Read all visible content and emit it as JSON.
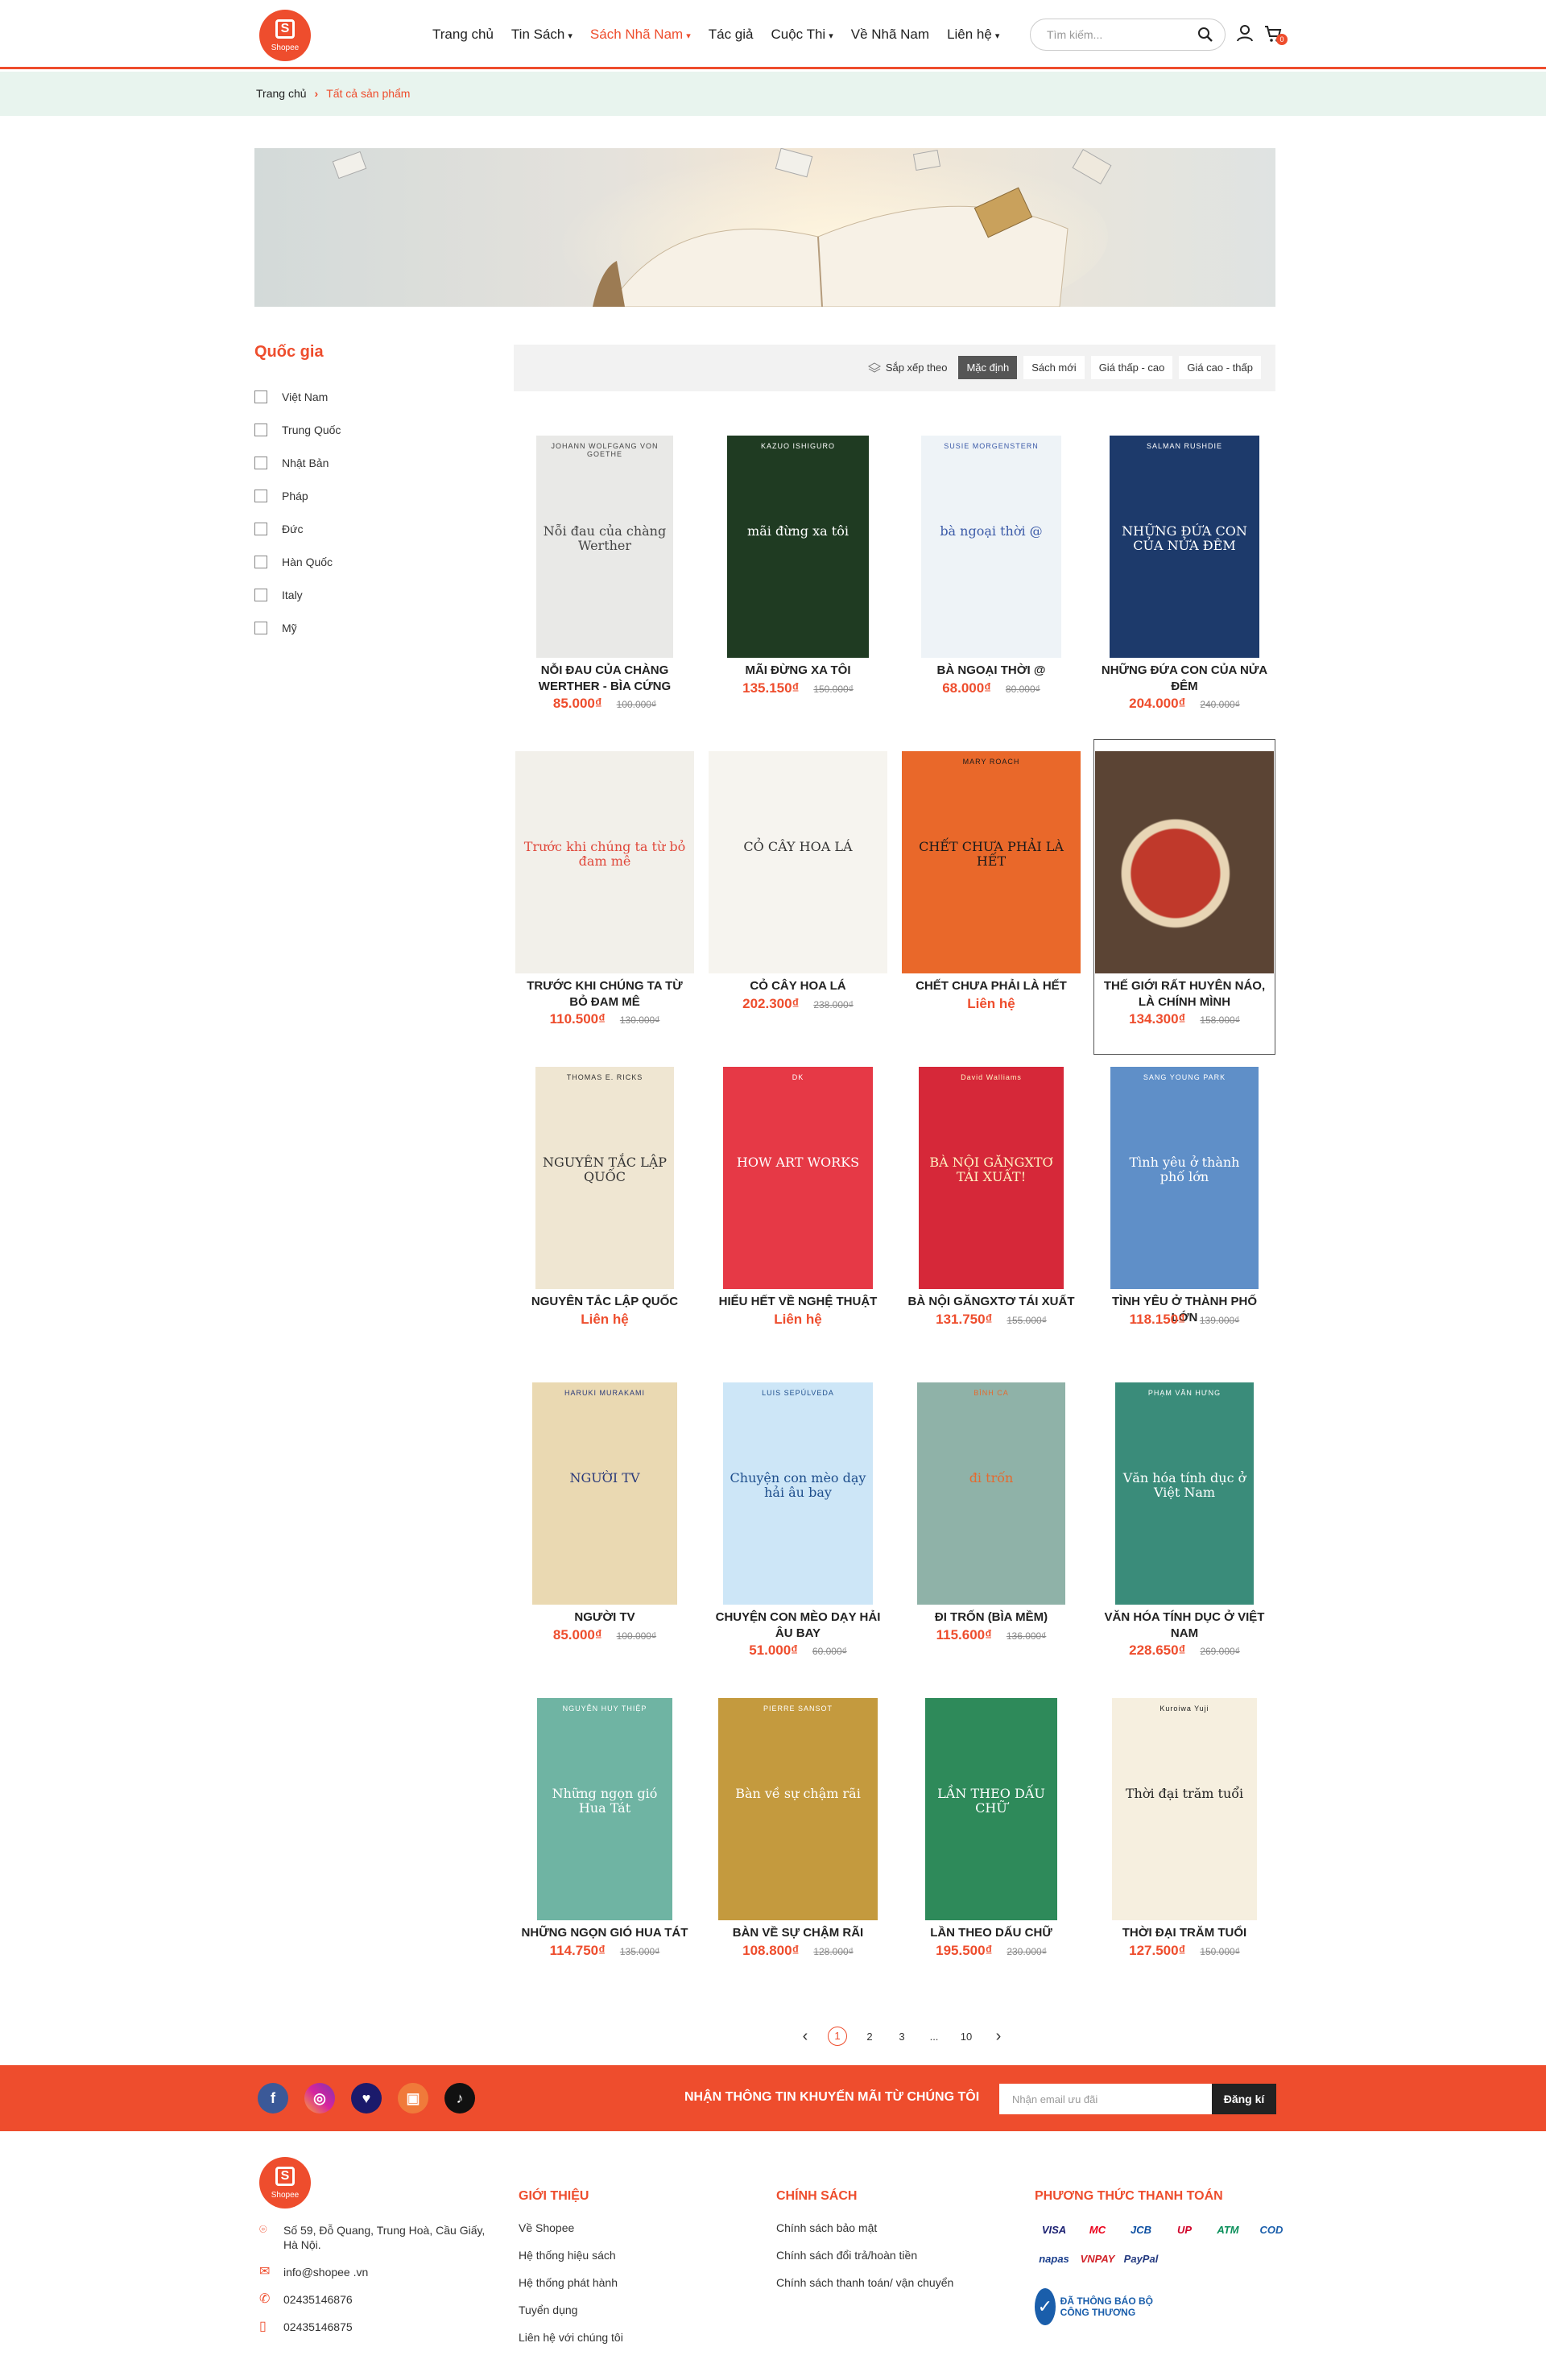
{
  "header": {
    "logo_text": "Shopee",
    "nav": [
      {
        "label": "Trang chủ",
        "dropdown": false,
        "active": false
      },
      {
        "label": "Tin Sách",
        "dropdown": true,
        "active": false
      },
      {
        "label": "Sách Nhã Nam",
        "dropdown": true,
        "active": true
      },
      {
        "label": "Tác giả",
        "dropdown": false,
        "active": false
      },
      {
        "label": "Cuộc Thi",
        "dropdown": true,
        "active": false
      },
      {
        "label": "Về Nhã Nam",
        "dropdown": false,
        "active": false
      },
      {
        "label": "Liên hệ",
        "dropdown": true,
        "active": false
      }
    ],
    "search_placeholder": "Tìm kiếm...",
    "cart_count": "0"
  },
  "breadcrumb": {
    "home": "Trang chủ",
    "current": "Tất cả sản phẩm"
  },
  "sidebar": {
    "title": "Quốc gia",
    "countries": [
      "Việt Nam",
      "Trung Quốc",
      "Nhật Bản",
      "Pháp",
      "Đức",
      "Hàn Quốc",
      "Italy",
      "Mỹ"
    ]
  },
  "sort": {
    "label": "Sắp xếp theo",
    "options": [
      "Mặc định",
      "Sách mới",
      "Giá thấp - cao",
      "Giá cao - thấp"
    ],
    "active": "Mặc định"
  },
  "products": [
    {
      "name": "Nỗi đau của chàng Werther - bìa cứng",
      "price": "85.000₫",
      "old": "100.000₫",
      "cover_title": "Nỗi đau của chàng Werther",
      "cover_author": "JOHANN WOLFGANG VON GOETHE",
      "bg": "#e9e9e7",
      "fg": "#444"
    },
    {
      "name": "Mãi đừng xa tôi",
      "price": "135.150₫",
      "old": "150.000₫",
      "cover_title": "mãi đừng xa tôi",
      "cover_author": "KAZUO ISHIGURO",
      "bg": "#1f3b22",
      "fg": "#fff"
    },
    {
      "name": "Bà ngoại thời @",
      "price": "68.000₫",
      "old": "80.000₫",
      "cover_title": "bà ngoại thời @",
      "cover_author": "SUSIE MORGENSTERN",
      "bg": "#eef3f7",
      "fg": "#3b5aa8"
    },
    {
      "name": "Những đứa con của nửa đêm",
      "price": "204.000₫",
      "old": "240.000₫",
      "cover_title": "NHỮNG ĐỨA CON CỦA NỬA ĐÊM",
      "cover_author": "SALMAN RUSHDIE",
      "bg": "#1d3a6b",
      "fg": "#fff"
    },
    {
      "name": "Trước khi chúng ta từ bỏ đam mê",
      "price": "110.500₫",
      "old": "130.000₫",
      "cover_title": "Trước khi chúng ta từ bỏ đam mê",
      "cover_author": "",
      "bg": "#f2f0ea",
      "fg": "#e0483b"
    },
    {
      "name": "Cỏ cây hoa lá",
      "price": "202.300₫",
      "old": "238.000₫",
      "cover_title": "CỎ CÂY HOA LÁ",
      "cover_author": "",
      "bg": "#f6f4ef",
      "fg": "#333"
    },
    {
      "name": "Chết chưa phải là hết",
      "price": "Liên hệ",
      "old": "",
      "cover_title": "CHẾT CHƯA PHẢI LÀ HẾT",
      "cover_author": "MARY ROACH",
      "bg": "#e9682a",
      "fg": "#1a1a1a"
    },
    {
      "name": "Thế giới rất huyên náo, là chính mình",
      "price": "134.300₫",
      "old": "158.000₫",
      "cover_title": "",
      "cover_author": "",
      "bg": "#5b4434",
      "fg": "#fff",
      "selected": true
    },
    {
      "name": "Nguyên tắc lập quốc",
      "price": "Liên hệ",
      "old": "",
      "cover_title": "NGUYÊN TẮC LẬP QUỐC",
      "cover_author": "THOMAS E. RICKS",
      "bg": "#efe6d2",
      "fg": "#333"
    },
    {
      "name": "Hiểu hết về nghệ thuật",
      "price": "Liên hệ",
      "old": "",
      "cover_title": "HOW ART WORKS",
      "cover_author": "DK",
      "bg": "#e63946",
      "fg": "#fff"
    },
    {
      "name": "Bà nội găngxtơ tái xuất",
      "price": "131.750₫",
      "old": "155.000₫",
      "cover_title": "BÀ NỘI GĂNGXTƠ TÁI XUẤT!",
      "cover_author": "David Walliams",
      "bg": "#d62839",
      "fg": "#fff4c2"
    },
    {
      "name": "Tình yêu ở thành phố lớn",
      "price": "118.150₫",
      "old": "139.000₫",
      "cover_title": "Tình yêu ở thành phố lớn",
      "cover_author": "SANG YOUNG PARK",
      "bg": "#5f8fc8",
      "fg": "#fff"
    },
    {
      "name": "Người TV",
      "price": "85.000₫",
      "old": "100.000₫",
      "cover_title": "NGƯỜI TV",
      "cover_author": "HARUKI MURAKAMI",
      "bg": "#ead9b2",
      "fg": "#2a3a7a"
    },
    {
      "name": "Chuyện con mèo dạy hải âu bay",
      "price": "51.000₫",
      "old": "60.000₫",
      "cover_title": "Chuyện con mèo dạy hải âu bay",
      "cover_author": "LUIS SEPÚLVEDA",
      "bg": "#cde6f7",
      "fg": "#1e4e8c"
    },
    {
      "name": "Đi trốn (bìa mềm)",
      "price": "115.600₫",
      "old": "136.000₫",
      "cover_title": "đi trốn",
      "cover_author": "BÌNH CA",
      "bg": "#8fb2a8",
      "fg": "#e56a2e"
    },
    {
      "name": "Văn hóa tính dục ở Việt Nam",
      "price": "228.650₫",
      "old": "269.000₫",
      "cover_title": "Văn hóa tính dục ở Việt Nam",
      "cover_author": "PHẠM VĂN HƯNG",
      "bg": "#3a8c7a",
      "fg": "#fff"
    },
    {
      "name": "Những ngọn gió Hua Tát",
      "price": "114.750₫",
      "old": "135.000₫",
      "cover_title": "Những ngọn gió Hua Tát",
      "cover_author": "NGUYỄN HUY THIỆP",
      "bg": "#6fb4a3",
      "fg": "#fff"
    },
    {
      "name": "Bàn về sự chậm rãi",
      "price": "108.800₫",
      "old": "128.000₫",
      "cover_title": "Bàn về sự chậm rãi",
      "cover_author": "PIERRE SANSOT",
      "bg": "#c49a3e",
      "fg": "#fff"
    },
    {
      "name": "Lần theo dấu chữ",
      "price": "195.500₫",
      "old": "230.000₫",
      "cover_title": "LẦN THEO DẤU CHỮ",
      "cover_author": "",
      "bg": "#2e8a5a",
      "fg": "#fff"
    },
    {
      "name": "Thời đại trăm tuổi",
      "price": "127.500₫",
      "old": "150.000₫",
      "cover_title": "Thời đại trăm tuổi",
      "cover_author": "Kuroiwa Yuji",
      "bg": "#f6efdf",
      "fg": "#222"
    }
  ],
  "pagination": {
    "pages": [
      "1",
      "2",
      "3",
      "...",
      "10"
    ],
    "current": "1",
    "prev": "‹",
    "next": "›"
  },
  "newsletter": {
    "title": "Nhận thông tin khuyến mãi từ chúng tôi",
    "placeholder": "Nhận email ưu đãi",
    "button": "Đăng kí"
  },
  "footer": {
    "address": "Số 59, Đỗ Quang, Trung Hoà, Cầu Giấy, Hà Nội.",
    "email": "info@shopee .vn",
    "phone1": "02435146876",
    "phone2": "02435146875",
    "intro_title": "Giới thiệu",
    "intro_links": [
      "Về Shopee",
      "Hệ thống hiệu sách",
      "Hệ thống phát hành",
      "Tuyển dụng",
      "Liên hệ với chúng tôi"
    ],
    "policy_title": "Chính sách",
    "policy_links": [
      "Chính sách bảo mật",
      "Chính sách đổi trả/hoàn tiền",
      "Chính sách thanh toán/ vận chuyển"
    ],
    "payment_title": "Phương thức thanh toán",
    "payments": [
      "VISA",
      "MC",
      "JCB",
      "UP",
      "ATM",
      "COD",
      "napas",
      "VNPAY",
      "PayPal"
    ],
    "badge": "ĐÃ THÔNG BÁO BỘ CÔNG THƯƠNG"
  }
}
